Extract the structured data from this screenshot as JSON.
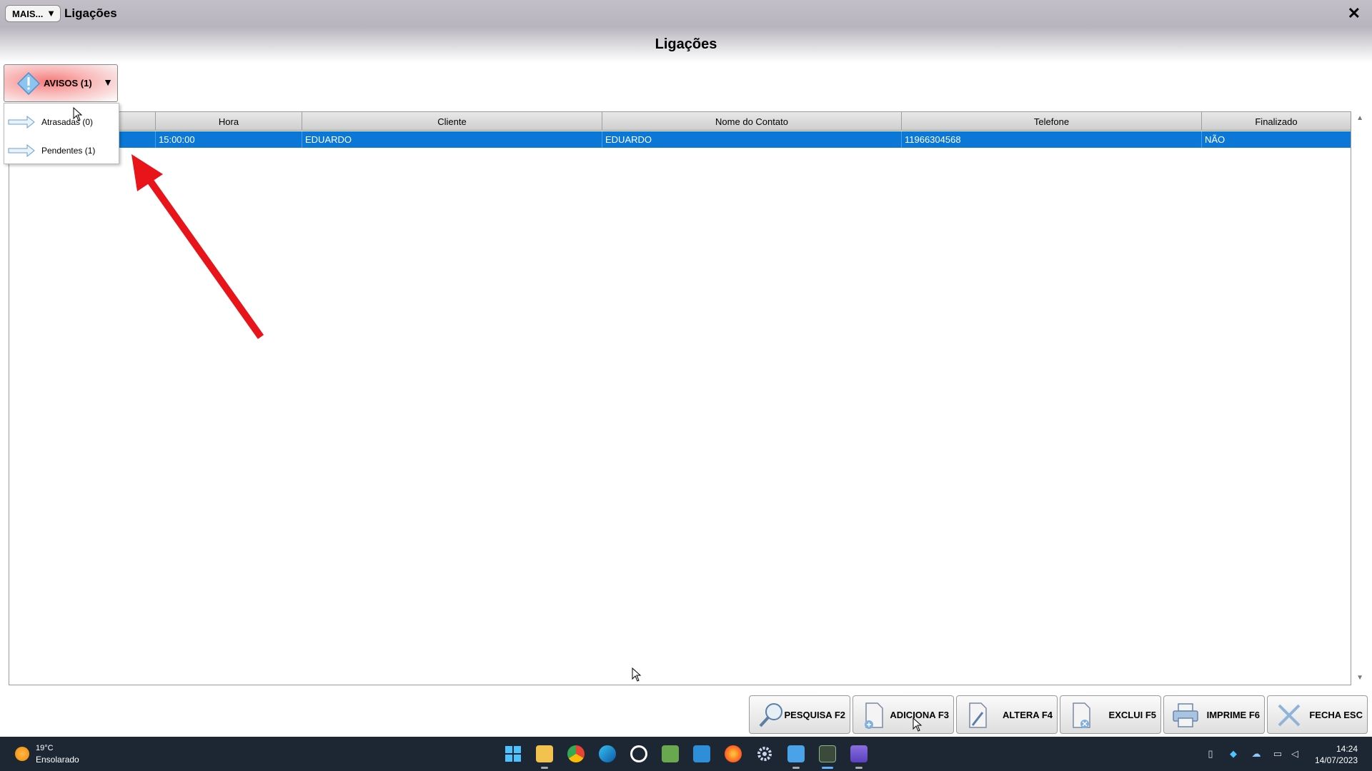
{
  "window": {
    "mais_label": "MAIS...",
    "title": "Ligações",
    "close_glyph": "✕"
  },
  "page": {
    "heading": "Ligações"
  },
  "avisos": {
    "label": "AVISOS (1)",
    "menu": [
      {
        "label": "Atrasadas (0)"
      },
      {
        "label": "Pendentes (1)"
      }
    ]
  },
  "table": {
    "columns": [
      "",
      "Hora",
      "Cliente",
      "Nome do Contato",
      "Telefone",
      "Finalizado"
    ],
    "rows": [
      {
        "cells": [
          "",
          "15:00:00",
          "EDUARDO",
          "EDUARDO",
          "11966304568",
          "NÃO"
        ]
      }
    ]
  },
  "buttons": {
    "pesquisa": "PESQUISA F2",
    "adiciona": "ADICIONA F3",
    "altera": "ALTERA F4",
    "exclui": "EXCLUI F5",
    "imprime": "IMPRIME F6",
    "fecha": "FECHA ESC"
  },
  "taskbar": {
    "weather_temp": "19°C",
    "weather_desc": "Ensolarado",
    "time": "14:24",
    "date": "14/07/2023"
  },
  "colors": {
    "selection": "#0b78d8",
    "arrow": "#e8141a",
    "taskbar": "#1c2733"
  }
}
